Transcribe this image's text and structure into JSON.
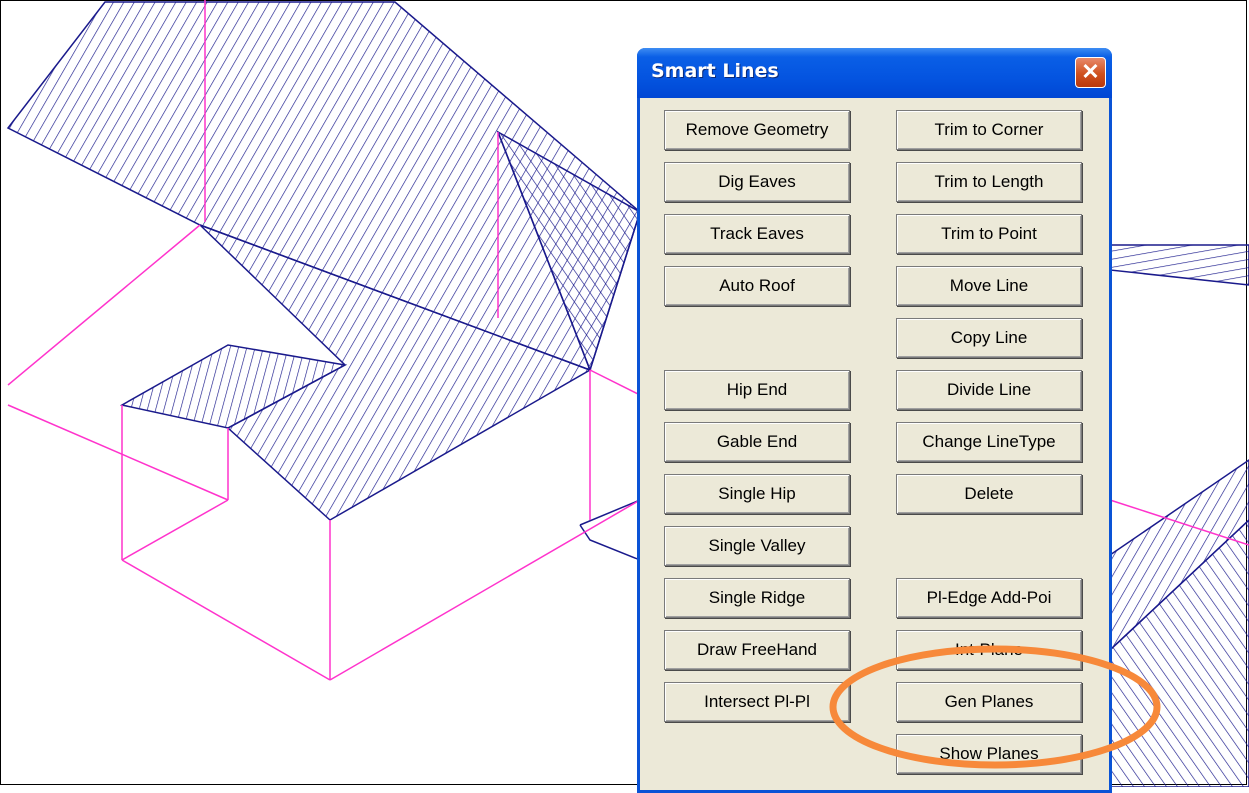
{
  "palette": {
    "title": "Smart Lines",
    "close_icon": "close-icon",
    "left_buttons": [
      "Remove Geometry",
      "Dig Eaves",
      "Track Eaves",
      "Auto Roof",
      "Hip End",
      "Gable End",
      "Single Hip",
      "Single Valley",
      "Single Ridge",
      "Draw FreeHand",
      "Intersect Pl-Pl"
    ],
    "right_buttons": [
      "Trim to Corner",
      "Trim to Length",
      "Trim to Point",
      "Move Line",
      "Copy Line",
      "Divide Line",
      "Change LineType",
      "Delete",
      "Pl-Edge Add-Poi",
      "Int-Plane",
      "Gen Planes",
      "Show Planes"
    ]
  },
  "colors": {
    "roof_hatch": "#1A1A8C",
    "wall_lines": "#FF33CC",
    "highlight": "#F7893A",
    "titlebar": "#0454E0",
    "panel": "#ECE9D8"
  }
}
